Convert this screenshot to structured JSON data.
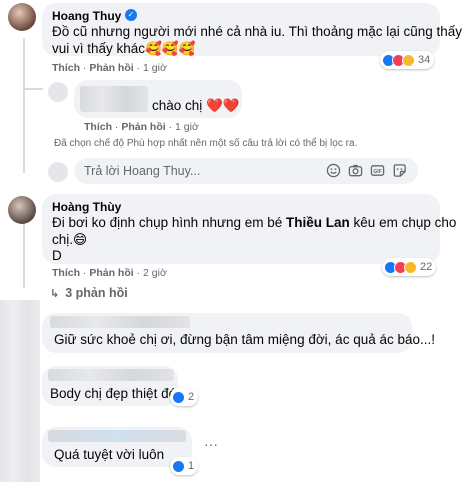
{
  "thread": {
    "c1": {
      "author": "Hoang Thuy",
      "text_line1": "Đồ cũ nhưng người mới nhé cả nhà iu. Thì thoảng mặc lại cũng thấy",
      "text_line2": "vui vì thấy khác🥰🥰🥰",
      "like": "Thích",
      "reply": "Phản hồi",
      "time": "1 giờ",
      "reaction_count": "34"
    },
    "reply1": {
      "text": "chào chị ❤️❤️",
      "like": "Thích",
      "reply": "Phản hồi",
      "time": "1 giờ"
    },
    "filter_notice": "Đã chọn chế độ Phù hợp nhất nên một số câu trả lời có thể bị lọc ra.",
    "reply_input": {
      "placeholder": "Trả lời Hoang Thuy..."
    },
    "c2": {
      "author": "Hoàng Thùy",
      "text_line1_a": "Đi bơi ko định chụp hình nhưng em bé ",
      "text_line1_b": "Thiều Lan",
      "text_line1_c": " kêu em chụp cho",
      "text_line2": "chị.😄",
      "text_line3": "D",
      "like": "Thích",
      "reply": "Phản hồi",
      "time": "2 giờ",
      "reaction_count": "22",
      "replies_link": "3 phản hồi"
    },
    "c3": {
      "text": "Giữ sức khoẻ chị ơi, đừng bận tâm miệng đời, ác quả ác báo...!"
    },
    "c4": {
      "text": "Body chị đẹp thiệt đó",
      "reaction_count": "2"
    },
    "c5": {
      "text": "Quá tuyệt vời luôn",
      "reaction_count": "1",
      "more": "···"
    }
  },
  "colors": {
    "bubble": "#f0f2f5",
    "meta_text": "#65676b",
    "like_blue": "#1877f2",
    "love_red": "#f33e58",
    "haha_yellow": "#f7b928",
    "verified": "#1877f2"
  }
}
